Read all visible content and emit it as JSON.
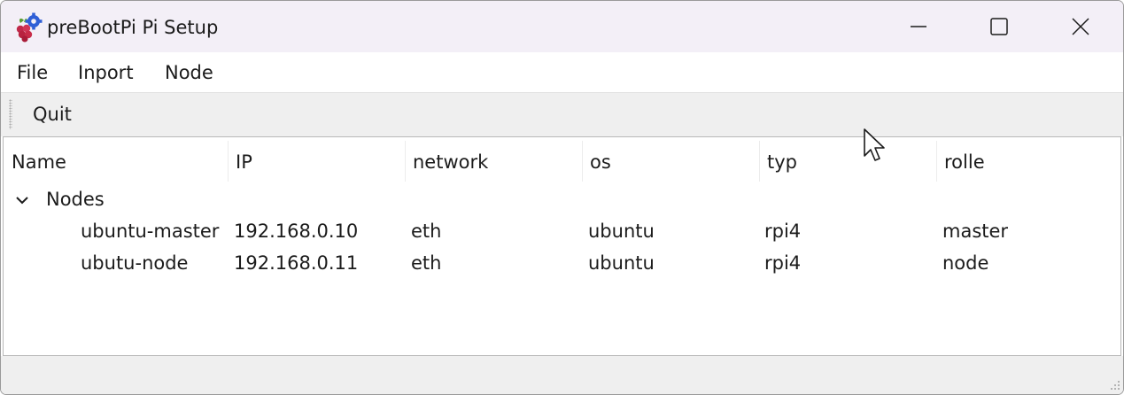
{
  "window": {
    "title": "preBootPi Pi Setup",
    "icon": "raspberry-gear-icon"
  },
  "menu": {
    "items": [
      {
        "label": "File"
      },
      {
        "label": "Inport"
      },
      {
        "label": "Node"
      }
    ]
  },
  "toolbar": {
    "quit_label": "Quit"
  },
  "tree": {
    "columns": [
      "Name",
      "IP",
      "network",
      "os",
      "typ",
      "rolle"
    ],
    "group": {
      "label": "Nodes",
      "expanded": true
    },
    "rows": [
      {
        "name": "ubuntu-master",
        "ip": "192.168.0.10",
        "network": "eth",
        "os": "ubuntu",
        "typ": "rpi4",
        "rolle": "master"
      },
      {
        "name": "ubutu-node",
        "ip": "192.168.0.11",
        "network": "eth",
        "os": "ubuntu",
        "typ": "rpi4",
        "rolle": "node"
      }
    ]
  },
  "colors": {
    "titlebar": "#f3eff7",
    "toolbar": "#efefef",
    "text": "#1b1b1b"
  }
}
